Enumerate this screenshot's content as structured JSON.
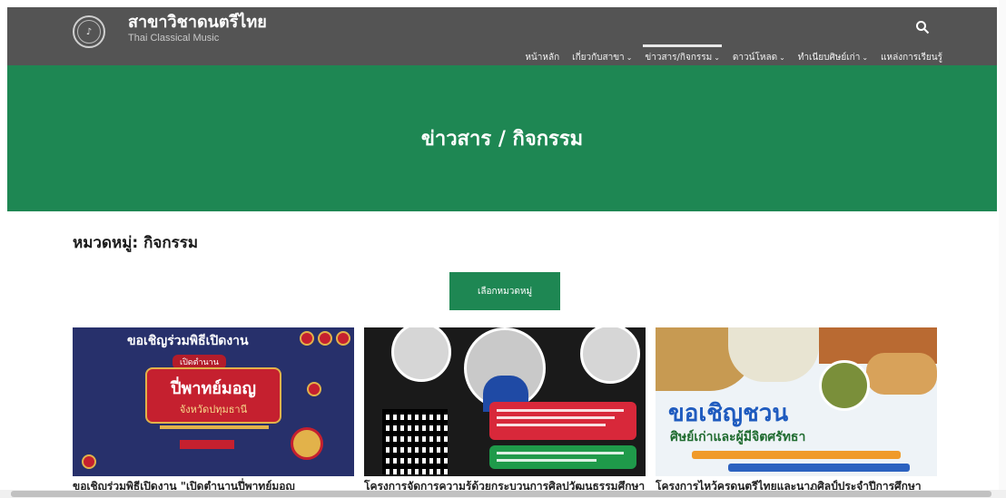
{
  "site": {
    "title": "สาขาวิชาดนตรีไทย",
    "subtitle": "Thai Classical Music"
  },
  "nav": {
    "items": [
      {
        "label": "หน้าหลัก",
        "dropdown": false
      },
      {
        "label": "เกี่ยวกับสาขา",
        "dropdown": true
      },
      {
        "label": "ข่าวสาร/กิจกรรม",
        "dropdown": true,
        "active": true
      },
      {
        "label": "ดาวน์โหลด",
        "dropdown": true
      },
      {
        "label": "ทำเนียบศิษย์เก่า",
        "dropdown": true
      },
      {
        "label": "แหล่งการเรียนรู้",
        "dropdown": false
      }
    ]
  },
  "banner": {
    "title": "ข่าวสาร / กิจกรรม"
  },
  "category": {
    "heading": "หมวดหมู่: กิจกรรม",
    "select_label": "เลือกหมวดหมู่"
  },
  "cards": [
    {
      "title": "ขอเชิญร่วมพิธีเปิดงาน \"เปิดตำนานปี่พาทย์มอญ",
      "poster_top": "ขอเชิญร่วมพิธีเปิดงาน",
      "poster_pill": "เปิดตำนาน",
      "poster_big": "ปี่พาทย์มอญ",
      "poster_sub": "จังหวัดปทุมธานี"
    },
    {
      "title": "โครงการจัดการความรู้ด้วยกระบวนการศิลปวัฒนธรรมศึกษา"
    },
    {
      "title": "โครงการไหว้ครูดนตรีไทยและนาฏศิลป์ประจำปีการศึกษา",
      "poster_invite": "ขอเชิญชวน",
      "poster_invite2": "ศิษย์เก่าและผู้มีจิตศรัทธา"
    }
  ],
  "icons": {
    "search": "search-icon",
    "logo": "logo-icon"
  },
  "colors": {
    "header": "#545454",
    "brand_green": "#1e8753"
  }
}
